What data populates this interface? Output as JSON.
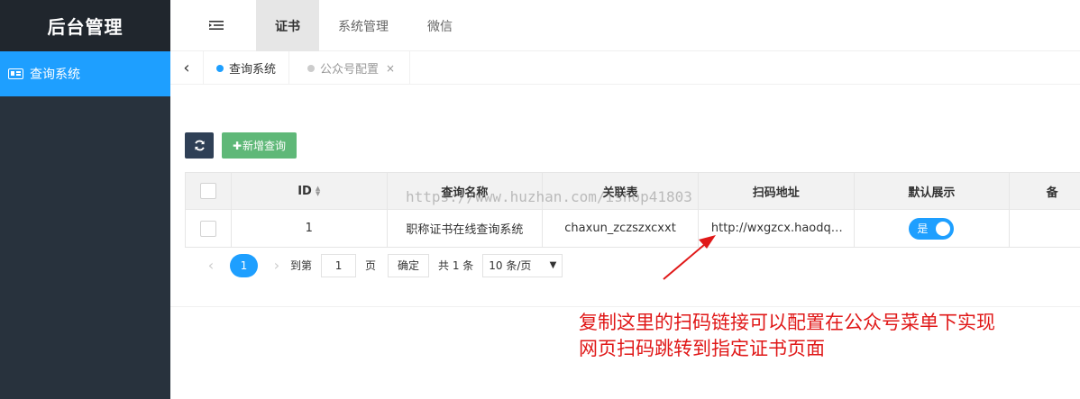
{
  "sidebar": {
    "title": "后台管理",
    "items": [
      {
        "label": "查询系统",
        "icon": "id-card-icon"
      }
    ]
  },
  "topbar": {
    "toggle_icon": "menu-toggle-icon",
    "tabs": [
      {
        "label": "证书",
        "active": true
      },
      {
        "label": "系统管理",
        "active": false
      },
      {
        "label": "微信",
        "active": false
      }
    ]
  },
  "tabsbar": {
    "prev_icon": "chevron-left-icon",
    "tabs": [
      {
        "label": "查询系统",
        "active": true,
        "dot_color": "#1e9fff"
      },
      {
        "label": "公众号配置",
        "active": false,
        "dot_color": "#cccccc",
        "close": "×"
      }
    ]
  },
  "toolbar": {
    "refresh_icon": "refresh-icon",
    "add_label": "新增查询",
    "add_icon": "plus-icon"
  },
  "table": {
    "columns": [
      "ID",
      "查询名称",
      "关联表",
      "扫码地址",
      "默认展示",
      "备"
    ],
    "rows": [
      {
        "id": "1",
        "name": "职称证书在线查询系统",
        "table": "chaxun_zczszxcxxt",
        "url": "http://wxgzcx.haodq…",
        "default": "是"
      }
    ]
  },
  "pager": {
    "current_page": "1",
    "goto_label": "到第",
    "goto_value": "1",
    "page_label": "页",
    "confirm_label": "确定",
    "total_label": "共 1 条",
    "page_size": "10 条/页"
  },
  "watermark": "https://www.huzhan.com/ishop41803",
  "annotation": {
    "line1": "复制这里的扫码链接可以配置在公众号菜单下实现",
    "line2": "网页扫码跳转到指定证书页面",
    "color": "#e01818"
  },
  "colors": {
    "sidebar_bg": "#28323d",
    "accent": "#1e9fff",
    "add_button": "#5fb878",
    "refresh_button": "#2f4056"
  }
}
